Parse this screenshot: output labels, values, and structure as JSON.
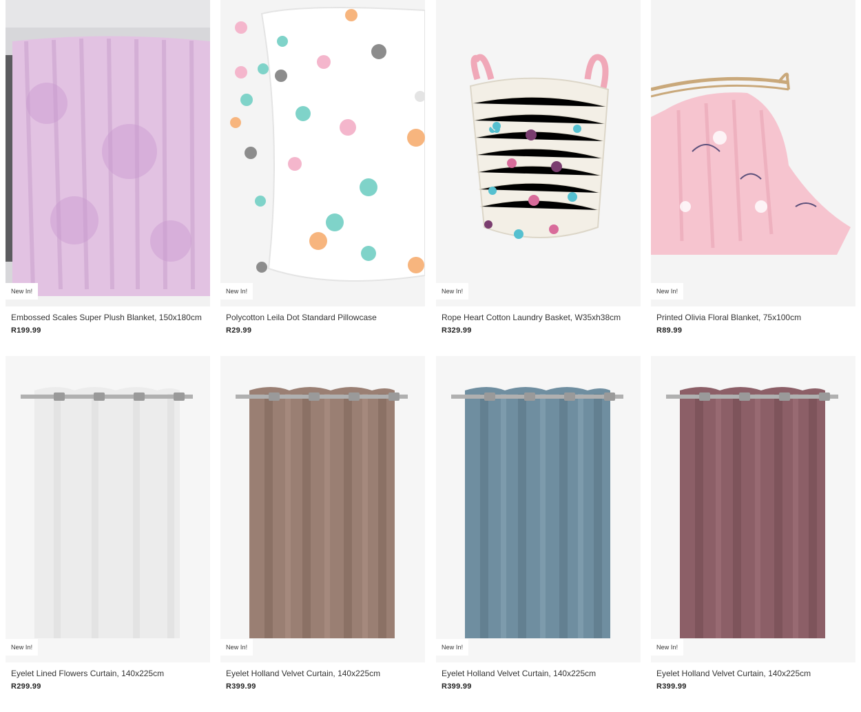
{
  "products": [
    {
      "name": "Embossed Scales Super Plush Blanket, 150x180cm",
      "price": "R199.99",
      "badge": "New In!",
      "image_icon": "plush-blanket-image"
    },
    {
      "name": "Polycotton Leila Dot Standard Pillowcase",
      "price": "R29.99",
      "badge": "New In!",
      "image_icon": "dot-pillowcase-image"
    },
    {
      "name": "Rope Heart Cotton Laundry Basket, W35xh38cm",
      "price": "R329.99",
      "badge": "New In!",
      "image_icon": "laundry-basket-image"
    },
    {
      "name": "Printed Olivia Floral Blanket, 75x100cm",
      "price": "R89.99",
      "badge": "New In!",
      "image_icon": "floral-blanket-image"
    },
    {
      "name": "Eyelet Lined Flowers Curtain, 140x225cm",
      "price": "R299.99",
      "badge": "New In!",
      "image_icon": "white-curtain-image"
    },
    {
      "name": "Eyelet Holland Velvet Curtain, 140x225cm",
      "price": "R399.99",
      "badge": "New In!",
      "image_icon": "taupe-curtain-image"
    },
    {
      "name": "Eyelet Holland Velvet Curtain, 140x225cm",
      "price": "R399.99",
      "badge": "New In!",
      "image_icon": "blue-curtain-image"
    },
    {
      "name": "Eyelet Holland Velvet Curtain, 140x225cm",
      "price": "R399.99",
      "badge": "New In!",
      "image_icon": "mauve-curtain-image"
    }
  ],
  "colors": {
    "blanket_lilac": "#d9b3da",
    "pillow_dots": [
      "#f4b6cc",
      "#7fd3c9",
      "#f7b57e",
      "#8c8c8c"
    ],
    "basket_hearts": [
      "#55c0d0",
      "#7a3d6f",
      "#d86b9a"
    ],
    "floral_pink": "#f6c4cf",
    "curtain_white": "#efefef",
    "curtain_taupe": "#9a7f73",
    "curtain_blue": "#6f8ea0",
    "curtain_mauve": "#8c5f67"
  }
}
